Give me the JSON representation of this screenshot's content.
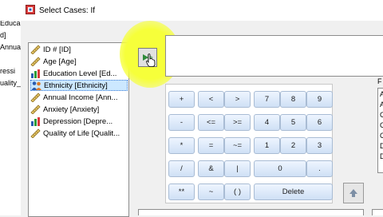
{
  "window": {
    "title": "Select Cases: If"
  },
  "background_window": {
    "fragments": [
      "Educa",
      "d]",
      "Annua",
      "ressi",
      "uality_"
    ]
  },
  "variables": [
    {
      "label": "ID # [ID]",
      "icon": "ruler-icon",
      "selected": false
    },
    {
      "label": "Age [Age]",
      "icon": "ruler-icon",
      "selected": false
    },
    {
      "label": "Education Level [Ed...",
      "icon": "bar-chart-icon",
      "selected": false
    },
    {
      "label": "Ethnicity [Ethnicity]",
      "icon": "nominal-people-icon",
      "selected": true
    },
    {
      "label": "Annual Income [Ann...",
      "icon": "ruler-icon",
      "selected": false
    },
    {
      "label": "Anxiety [Anxiety]",
      "icon": "ruler-icon",
      "selected": false
    },
    {
      "label": "Depression [Depre...",
      "icon": "bar-chart-icon",
      "selected": false
    },
    {
      "label": "Quality of Life [Qualit...",
      "icon": "ruler-icon",
      "selected": false
    }
  ],
  "keypad": {
    "row1": [
      "+",
      "<",
      ">",
      "7",
      "8",
      "9"
    ],
    "row2": [
      "-",
      "<=",
      ">=",
      "4",
      "5",
      "6"
    ],
    "row3": [
      "*",
      "=",
      "~=",
      "1",
      "2",
      "3"
    ],
    "row4": [
      "/",
      "&",
      "|",
      "0",
      "."
    ],
    "row5": [
      "**",
      "~",
      "( )",
      "Delete"
    ]
  },
  "function_group": {
    "label": "F",
    "items": [
      "A",
      "A",
      "C",
      "C",
      "C",
      "D",
      "D"
    ]
  },
  "colors": {
    "accent": "#f6ff3a",
    "selection": "#cce8ff"
  }
}
